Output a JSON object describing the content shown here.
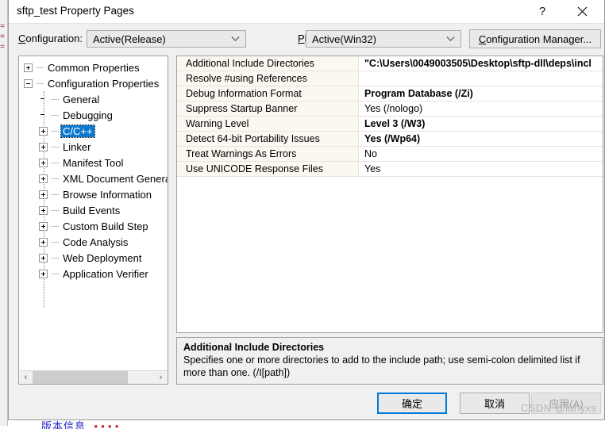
{
  "window": {
    "title": "sftp_test Property Pages",
    "help_glyph": "?",
    "close_glyph": "✕"
  },
  "toolbar": {
    "configuration_label": "Configuration:",
    "configuration_value": "Active(Release)",
    "platform_label": "Platform:",
    "platform_value": "Active(Win32)",
    "configuration_manager_label": "Configuration Manager..."
  },
  "tree": {
    "nodes": [
      {
        "label": "Common Properties",
        "level": 0,
        "expander": "plus",
        "selected": false
      },
      {
        "label": "Configuration Properties",
        "level": 0,
        "expander": "minus",
        "selected": false
      },
      {
        "label": "General",
        "level": 1,
        "expander": "none",
        "selected": false
      },
      {
        "label": "Debugging",
        "level": 1,
        "expander": "none",
        "selected": false
      },
      {
        "label": "C/C++",
        "level": 1,
        "expander": "plus",
        "selected": true
      },
      {
        "label": "Linker",
        "level": 1,
        "expander": "plus",
        "selected": false
      },
      {
        "label": "Manifest Tool",
        "level": 1,
        "expander": "plus",
        "selected": false
      },
      {
        "label": "XML Document Generat",
        "level": 1,
        "expander": "plus",
        "selected": false
      },
      {
        "label": "Browse Information",
        "level": 1,
        "expander": "plus",
        "selected": false
      },
      {
        "label": "Build Events",
        "level": 1,
        "expander": "plus",
        "selected": false
      },
      {
        "label": "Custom Build Step",
        "level": 1,
        "expander": "plus",
        "selected": false
      },
      {
        "label": "Code Analysis",
        "level": 1,
        "expander": "plus",
        "selected": false
      },
      {
        "label": "Web Deployment",
        "level": 1,
        "expander": "plus",
        "selected": false
      },
      {
        "label": "Application Verifier",
        "level": 1,
        "expander": "plus",
        "selected": false
      }
    ],
    "scroll_left_glyph": "‹",
    "scroll_right_glyph": "›"
  },
  "grid": {
    "rows": [
      {
        "name": "Additional Include Directories",
        "value": "\"C:\\Users\\0049003505\\Desktop\\sftp-dll\\deps\\incl",
        "bold": true
      },
      {
        "name": "Resolve #using References",
        "value": "",
        "bold": false
      },
      {
        "name": "Debug Information Format",
        "value": "Program Database (/Zi)",
        "bold": true
      },
      {
        "name": "Suppress Startup Banner",
        "value": "Yes (/nologo)",
        "bold": false
      },
      {
        "name": "Warning Level",
        "value": "Level 3 (/W3)",
        "bold": true
      },
      {
        "name": "Detect 64-bit Portability Issues",
        "value": "Yes (/Wp64)",
        "bold": true
      },
      {
        "name": "Treat Warnings As Errors",
        "value": "No",
        "bold": false
      },
      {
        "name": "Use UNICODE Response Files",
        "value": "Yes",
        "bold": false
      }
    ]
  },
  "description": {
    "title": "Additional Include Directories",
    "body": "Specifies one or more directories to add to the include path; use semi-colon delimited list if more than one.     (/I[path])"
  },
  "buttons": {
    "ok": "确定",
    "cancel": "取消",
    "apply": "应用(A)"
  },
  "watermark": "CSDN @lanyxs",
  "background": {
    "bottom_code_blue": "版本信息",
    "bottom_code_red": "••••"
  },
  "colors": {
    "accent": "#0078d7",
    "selection": "#0b79d0",
    "dialog_bg": "#f0f0f0",
    "grid_name_bg": "#faf8f0"
  }
}
